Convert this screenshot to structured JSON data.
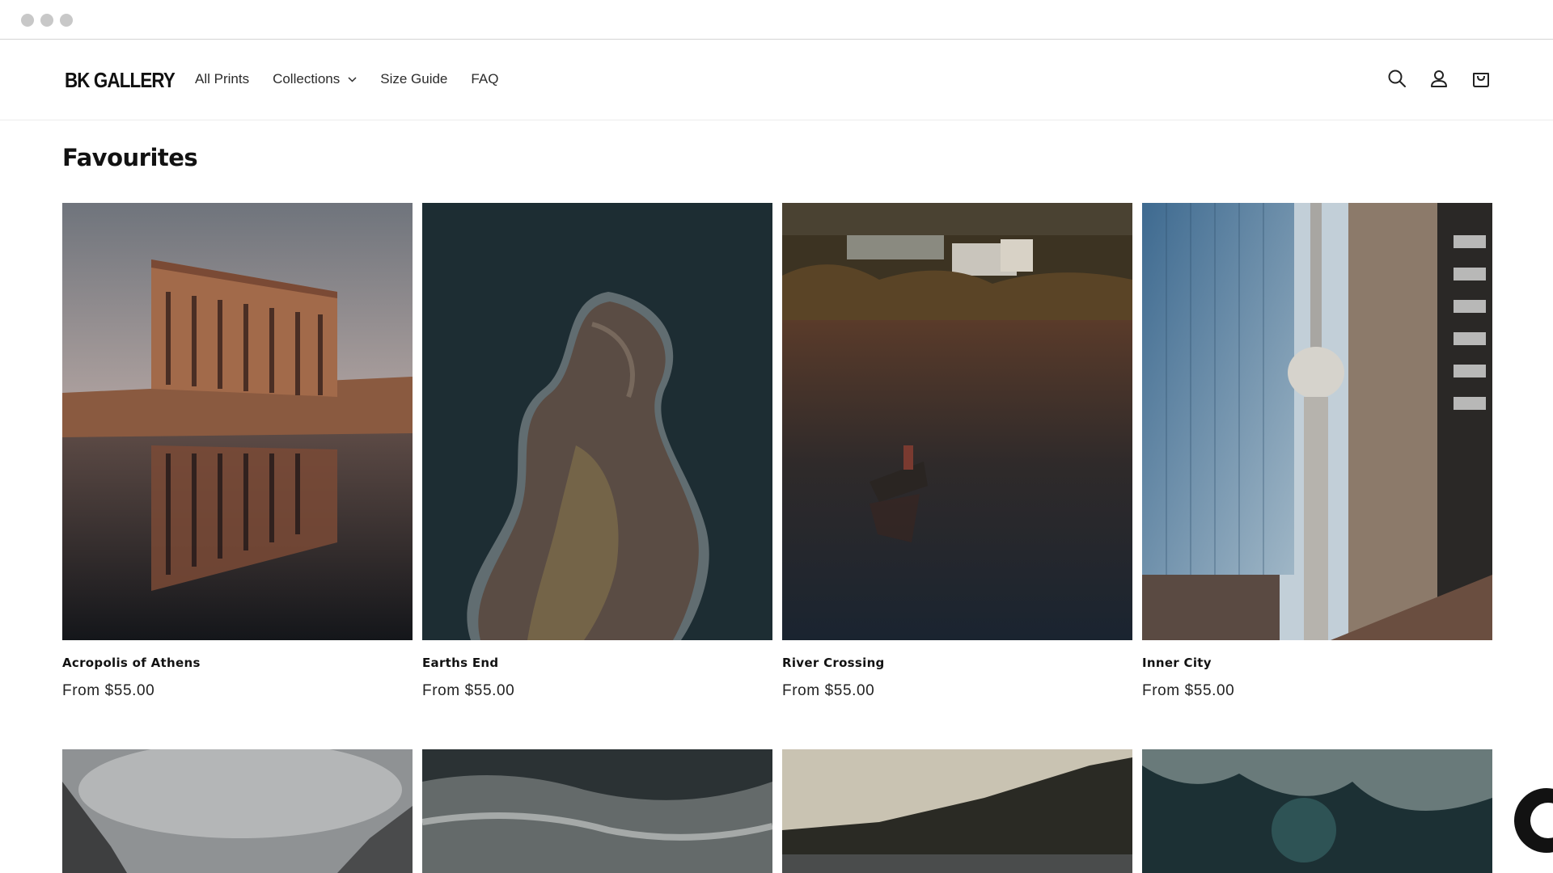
{
  "window": {
    "controls": [
      "close",
      "minimize",
      "maximize"
    ]
  },
  "header": {
    "logo": "BK GALLERY",
    "nav": [
      {
        "label": "All Prints"
      },
      {
        "label": "Collections",
        "dropdown": true
      },
      {
        "label": "Size Guide"
      },
      {
        "label": "FAQ"
      }
    ],
    "icons": [
      "search-icon",
      "account-icon",
      "cart-icon"
    ]
  },
  "section": {
    "title": "Favourites"
  },
  "products": [
    {
      "title": "Acropolis of Athens",
      "price": "From $55.00",
      "image": "acropolis"
    },
    {
      "title": "Earths End",
      "price": "From $55.00",
      "image": "island-aerial"
    },
    {
      "title": "River Crossing",
      "price": "From $55.00",
      "image": "river-boat"
    },
    {
      "title": "Inner City",
      "price": "From $55.00",
      "image": "city-tower"
    }
  ],
  "next_row_images": [
    "misty-mountains",
    "ocean-waves",
    "lake-hills",
    "sea-foam"
  ],
  "colors": {
    "text": "#121212",
    "background": "#ffffff",
    "border": "#ececec"
  },
  "chat_widget": {
    "icon": "chat-icon"
  }
}
